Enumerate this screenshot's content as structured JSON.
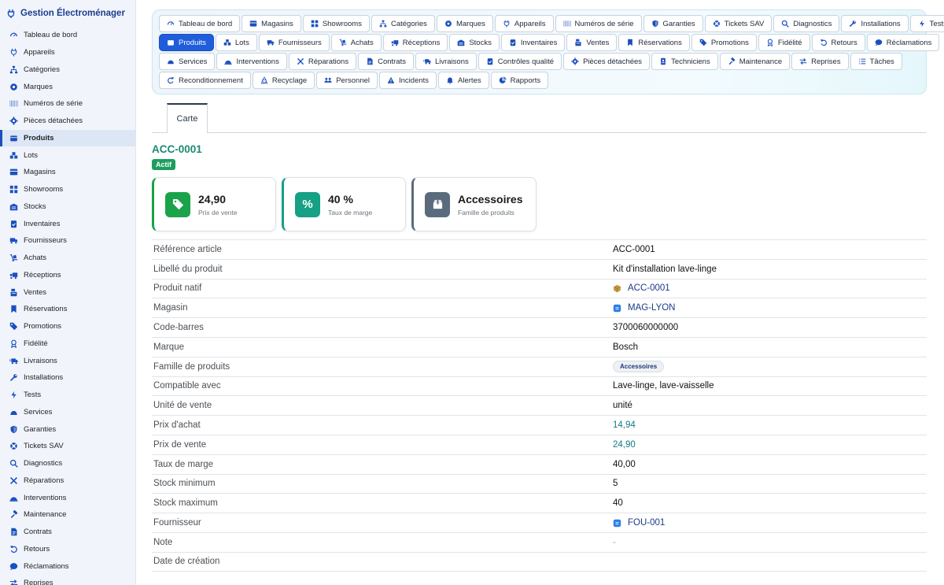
{
  "app": {
    "title": "Gestion Électroménager"
  },
  "sidebar": {
    "items": [
      {
        "label": "Tableau de bord",
        "icon": "gauge-icon"
      },
      {
        "label": "Appareils",
        "icon": "plug-icon"
      },
      {
        "label": "Catégories",
        "icon": "sitemap-icon"
      },
      {
        "label": "Marques",
        "icon": "badge-icon"
      },
      {
        "label": "Numéros de série",
        "icon": "barcode-icon"
      },
      {
        "label": "Pièces détachées",
        "icon": "cog-icon"
      },
      {
        "label": "Produits",
        "icon": "box-icon",
        "active": true
      },
      {
        "label": "Lots",
        "icon": "boxes-icon"
      },
      {
        "label": "Magasins",
        "icon": "store-icon"
      },
      {
        "label": "Showrooms",
        "icon": "grid-icon"
      },
      {
        "label": "Stocks",
        "icon": "warehouse-icon"
      },
      {
        "label": "Inventaires",
        "icon": "clipboard-check-icon"
      },
      {
        "label": "Fournisseurs",
        "icon": "truck-icon"
      },
      {
        "label": "Achats",
        "icon": "dolly-icon"
      },
      {
        "label": "Réceptions",
        "icon": "truck-loading-icon"
      },
      {
        "label": "Ventes",
        "icon": "cash-register-icon"
      },
      {
        "label": "Réservations",
        "icon": "bookmark-icon"
      },
      {
        "label": "Promotions",
        "icon": "tags-icon"
      },
      {
        "label": "Fidélité",
        "icon": "award-icon"
      },
      {
        "label": "Livraisons",
        "icon": "shipping-fast-icon"
      },
      {
        "label": "Installations",
        "icon": "wrench-icon"
      },
      {
        "label": "Tests",
        "icon": "bolt-icon"
      },
      {
        "label": "Services",
        "icon": "concierge-icon"
      },
      {
        "label": "Garanties",
        "icon": "shield-icon"
      },
      {
        "label": "Tickets SAV",
        "icon": "lifebuoy-icon"
      },
      {
        "label": "Diagnostics",
        "icon": "search-icon"
      },
      {
        "label": "Réparations",
        "icon": "tools-icon"
      },
      {
        "label": "Interventions",
        "icon": "helmet-icon"
      },
      {
        "label": "Maintenance",
        "icon": "hammer-icon"
      },
      {
        "label": "Contrats",
        "icon": "file-contract-icon"
      },
      {
        "label": "Retours",
        "icon": "undo-icon"
      },
      {
        "label": "Réclamations",
        "icon": "comment-icon"
      },
      {
        "label": "Reprises",
        "icon": "exchange-icon"
      }
    ]
  },
  "nav": {
    "rows": [
      [
        {
          "label": "Tableau de bord",
          "icon": "gauge-icon"
        },
        {
          "label": "Magasins",
          "icon": "store-icon"
        },
        {
          "label": "Showrooms",
          "icon": "grid-icon"
        },
        {
          "label": "Catégories",
          "icon": "sitemap-icon"
        },
        {
          "label": "Marques",
          "icon": "badge-icon"
        },
        {
          "label": "Appareils",
          "icon": "plug-icon"
        },
        {
          "label": "Numéros de série",
          "icon": "barcode-icon"
        },
        {
          "label": "Garanties",
          "icon": "shield-icon"
        },
        {
          "label": "Tickets SAV",
          "icon": "lifebuoy-icon"
        },
        {
          "label": "Diagnostics",
          "icon": "search-icon"
        },
        {
          "label": "Installations",
          "icon": "wrench-icon"
        },
        {
          "label": "Tests",
          "icon": "bolt-icon"
        }
      ],
      [
        {
          "label": "Produits",
          "icon": "box-icon",
          "active": true
        },
        {
          "label": "Lots",
          "icon": "boxes-icon"
        },
        {
          "label": "Fournisseurs",
          "icon": "truck-icon"
        },
        {
          "label": "Achats",
          "icon": "dolly-icon"
        },
        {
          "label": "Réceptions",
          "icon": "truck-loading-icon"
        },
        {
          "label": "Stocks",
          "icon": "warehouse-icon"
        },
        {
          "label": "Inventaires",
          "icon": "clipboard-check-icon"
        },
        {
          "label": "Ventes",
          "icon": "cash-register-icon"
        },
        {
          "label": "Réservations",
          "icon": "bookmark-icon"
        },
        {
          "label": "Promotions",
          "icon": "tags-icon"
        },
        {
          "label": "Fidélité",
          "icon": "award-icon"
        },
        {
          "label": "Retours",
          "icon": "undo-icon"
        },
        {
          "label": "Réclamations",
          "icon": "comment-icon"
        }
      ],
      [
        {
          "label": "Services",
          "icon": "concierge-icon"
        },
        {
          "label": "Interventions",
          "icon": "helmet-icon"
        },
        {
          "label": "Réparations",
          "icon": "tools-icon"
        },
        {
          "label": "Contrats",
          "icon": "file-contract-icon"
        },
        {
          "label": "Livraisons",
          "icon": "shipping-fast-icon"
        },
        {
          "label": "Contrôles qualité",
          "icon": "clipboard-check-icon"
        },
        {
          "label": "Pièces détachées",
          "icon": "cog-icon"
        },
        {
          "label": "Techniciens",
          "icon": "id-badge-icon"
        },
        {
          "label": "Maintenance",
          "icon": "hammer-icon"
        },
        {
          "label": "Reprises",
          "icon": "exchange-icon"
        },
        {
          "label": "Tâches",
          "icon": "tasks-icon"
        }
      ],
      [
        {
          "label": "Reconditionnement",
          "icon": "redo-icon"
        },
        {
          "label": "Recyclage",
          "icon": "recycle-icon"
        },
        {
          "label": "Personnel",
          "icon": "users-icon"
        },
        {
          "label": "Incidents",
          "icon": "warning-icon"
        },
        {
          "label": "Alertes",
          "icon": "bell-icon"
        },
        {
          "label": "Rapports",
          "icon": "chart-pie-icon"
        }
      ]
    ]
  },
  "tabs": {
    "active": "Carte"
  },
  "record": {
    "title": "ACC-0001",
    "status": "Actif",
    "cards": [
      {
        "value": "24,90",
        "label": "Prix de vente",
        "icon": "tag-icon",
        "color": "#1aa34a"
      },
      {
        "value": "40 %",
        "label": "Taux de marge",
        "icon": "percent-icon",
        "color": "#16a085"
      },
      {
        "value": "Accessoires",
        "label": "Famille de produits",
        "icon": "box-open-icon",
        "color": "#5a6b7e"
      }
    ],
    "fields": [
      {
        "label": "Référence article",
        "value": "ACC-0001"
      },
      {
        "label": "Libellé du produit",
        "value": "Kit d'installation lave-linge"
      },
      {
        "label": "Produit natif",
        "value": "ACC-0001",
        "type": "link",
        "icon": "cube-icon"
      },
      {
        "label": "Magasin",
        "value": "MAG-LYON",
        "type": "link",
        "icon": "app-icon"
      },
      {
        "label": "Code-barres",
        "value": "3700060000000"
      },
      {
        "label": "Marque",
        "value": "Bosch"
      },
      {
        "label": "Famille de produits",
        "value": "Accessoires",
        "type": "pill"
      },
      {
        "label": "Compatible avec",
        "value": "Lave-linge, lave-vaisselle"
      },
      {
        "label": "Unité de vente",
        "value": "unité"
      },
      {
        "label": "Prix d'achat",
        "value": "14,94",
        "type": "teal"
      },
      {
        "label": "Prix de vente",
        "value": "24,90",
        "type": "teal"
      },
      {
        "label": "Taux de marge",
        "value": "40,00"
      },
      {
        "label": "Stock minimum",
        "value": "5"
      },
      {
        "label": "Stock maximum",
        "value": "40"
      },
      {
        "label": "Fournisseur",
        "value": "FOU-001",
        "type": "link",
        "icon": "app-icon"
      },
      {
        "label": "Note",
        "value": "-",
        "type": "muted"
      },
      {
        "label": "Date de création",
        "value": ""
      }
    ]
  },
  "colors": {
    "primary": "#1f5ddb",
    "teal": "#1a8a72",
    "success": "#1e9e5e"
  }
}
